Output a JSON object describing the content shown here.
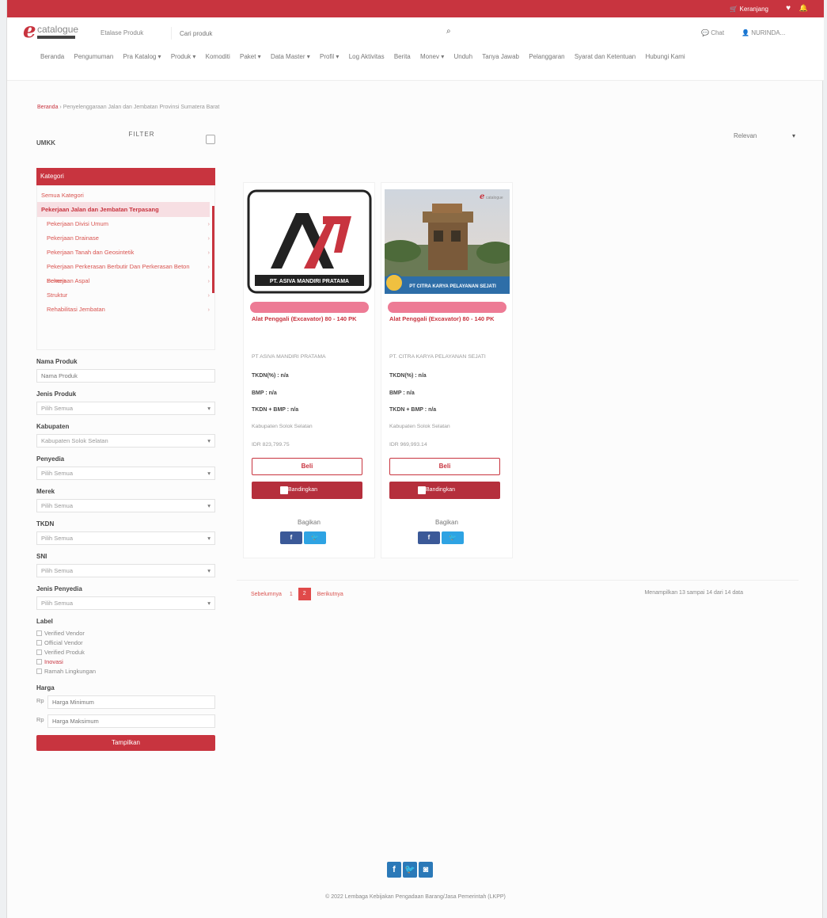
{
  "colors": {
    "brand": "#c8343f",
    "badge": "#ed7b95",
    "facebook": "#3b5998",
    "twitter": "#2ea3e3"
  },
  "topbar": {
    "cart_label": "Keranjang",
    "heart_icon": "heart-icon",
    "bell_icon": "bell-icon"
  },
  "header": {
    "logo_letter": "e",
    "logo_word": "catalogue",
    "scope_label": "Etalase Produk",
    "search_placeholder": "Cari produk",
    "chat_label": "Chat",
    "user_label": "NURINDA..."
  },
  "nav": [
    "Beranda",
    "Pengumuman",
    "Pra Katalog ▾",
    "Produk ▾",
    "Komoditi",
    "Paket ▾",
    "Data Master ▾",
    "Profil ▾",
    "Log Aktivitas",
    "Berita",
    "Monev ▾",
    "Unduh",
    "Tanya Jawab",
    "Pelanggaran",
    "Syarat dan Ketentuan",
    "Hubungi Kami"
  ],
  "breadcrumb": {
    "home": "Beranda",
    "sep": " › ",
    "current": "Penyelenggaraan Jalan dan Jembatan Provinsi Sumatera Barat"
  },
  "sidebar": {
    "filter_title": "FILTER",
    "umkm_label": "UMKK",
    "category_header": "Kategori",
    "all_categories": "Semua Kategori",
    "main_category": "Pekerjaan Jalan dan Jembatan Terpasang",
    "subcategories": [
      "Pekerjaan Divisi Umum",
      "Pekerjaan Drainase",
      "Pekerjaan Tanah dan Geosintetik",
      "Pekerjaan Perkerasan Berbutir Dan Perkerasan Beton Semen",
      "Pekerjaan Aspal",
      "Struktur",
      "Rehabilitasi Jembatan"
    ],
    "nama_produk": {
      "label": "Nama Produk",
      "placeholder": "Nama Produk"
    },
    "jenis_produk": {
      "label": "Jenis Produk",
      "value": "Pilih Semua"
    },
    "kabupaten": {
      "label": "Kabupaten",
      "value": "Kabupaten Solok Selatan"
    },
    "penyedia": {
      "label": "Penyedia",
      "value": "Pilih Semua"
    },
    "merek": {
      "label": "Merek",
      "value": "Pilih Semua"
    },
    "tkdn": {
      "label": "TKDN",
      "value": "Pilih Semua"
    },
    "sni": {
      "label": "SNI",
      "value": "Pilih Semua"
    },
    "jenis_penyedia": {
      "label": "Jenis Penyedia",
      "value": "Pilih Semua"
    },
    "label_title": "Label",
    "labels": [
      "Verified Vendor",
      "Official Vendor",
      "Verified Produk",
      "Inovasi",
      "Ramah Lingkungan"
    ],
    "harga": {
      "label": "Harga",
      "currency": "Rp",
      "min_placeholder": "Harga Minimum",
      "max_placeholder": "Harga Maksimum"
    },
    "apply_label": "Tampilkan"
  },
  "sort": {
    "value": "Relevan"
  },
  "products": [
    {
      "logo_text": "PT. ASIVA MANDIRI PRATAMA",
      "name": "Alat Penggali (Excavator) 80 - 140 PK",
      "vendor": "PT ASIVA MANDIRI PRATAMA",
      "tkdn": "TKDN(%) : n/a",
      "bmp": "BMP : n/a",
      "tkdn_bmp": "TKDN + BMP : n/a",
      "region": "Kabupaten Solok Selatan",
      "price": "IDR 823,799.75",
      "buy_label": "Beli",
      "compare_label": "Bandingkan",
      "share_label": "Bagikan"
    },
    {
      "logo_text": "PT CITRA KARYA PELAYANAN SEJATI",
      "name": "Alat Penggali (Excavator) 80 - 140 PK",
      "vendor": "PT. CITRA KARYA PELAYANAN SEJATI",
      "tkdn": "TKDN(%) : n/a",
      "bmp": "BMP : n/a",
      "tkdn_bmp": "TKDN + BMP : n/a",
      "region": "Kabupaten Solok Selatan",
      "price": "IDR 969,993.14",
      "buy_label": "Beli",
      "compare_label": "Bandingkan",
      "share_label": "Bagikan"
    }
  ],
  "pagination": {
    "prev": "Sebelumnya",
    "page1": "1",
    "page2": "2",
    "next": "Berikutnya"
  },
  "showing": "Menampilkan 13 sampai 14 dari 14 data",
  "footer": {
    "copyright": "© 2022 Lembaga Kebijakan Pengadaan Barang/Jasa Pemerintah (LKPP)"
  }
}
